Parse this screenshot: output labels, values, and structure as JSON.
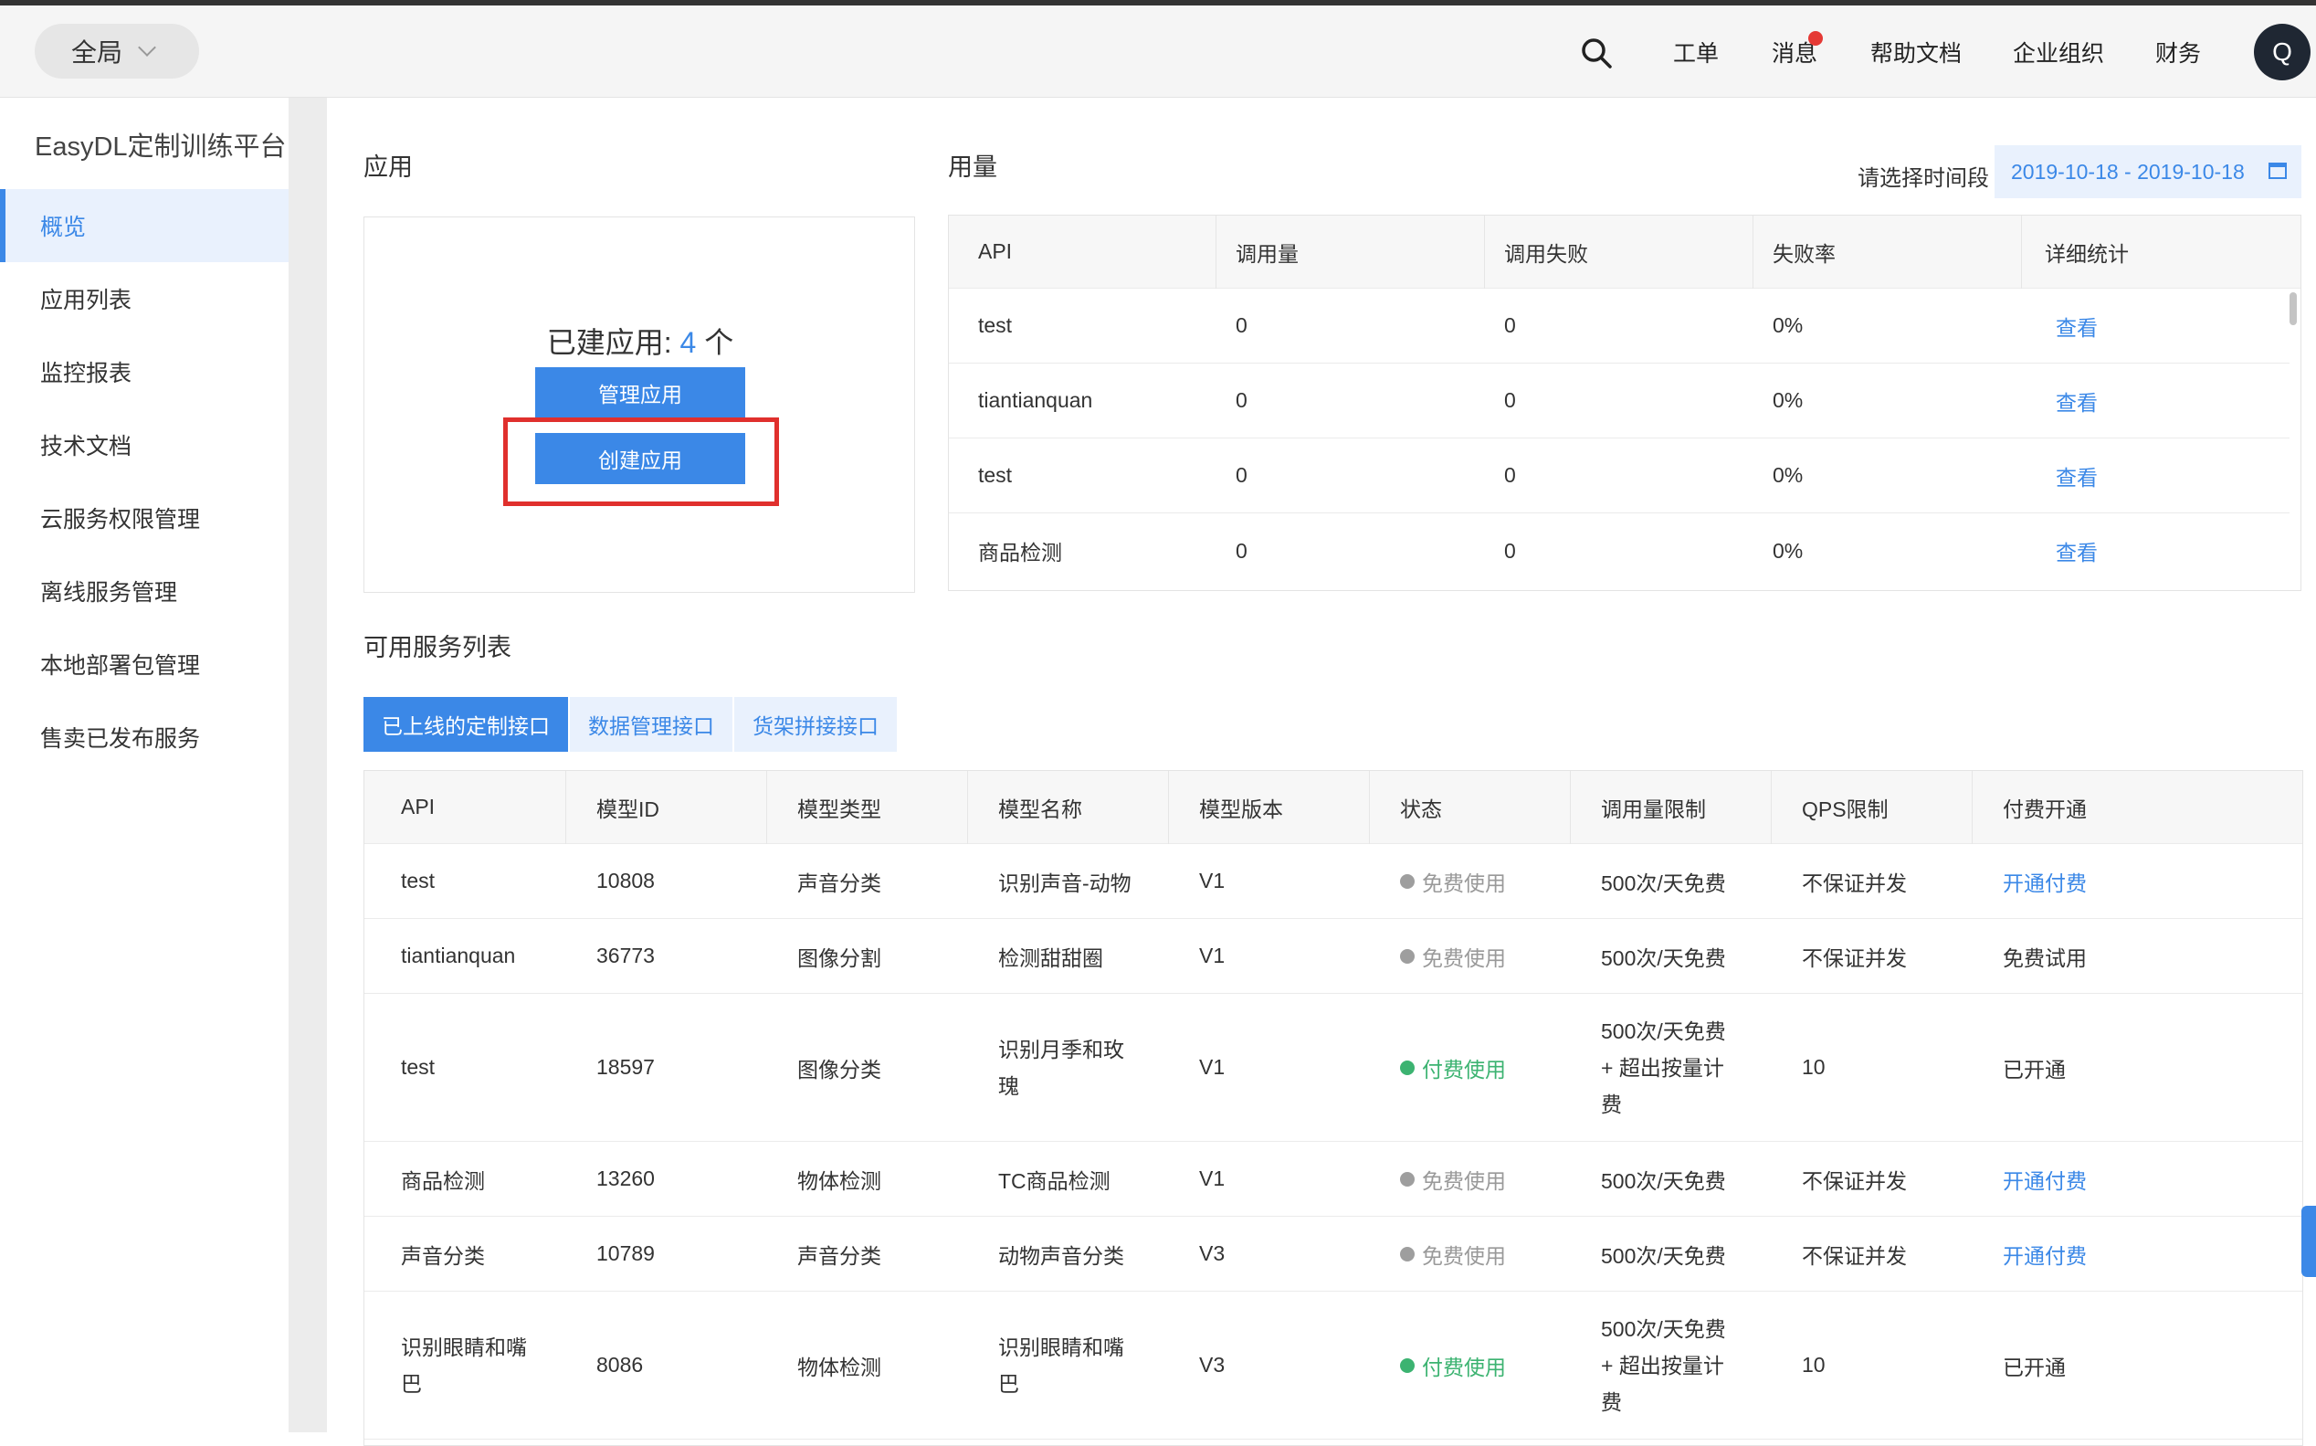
{
  "header": {
    "scope": "全局",
    "nav": [
      {
        "label": "工单"
      },
      {
        "label": "消息"
      },
      {
        "label": "帮助文档"
      },
      {
        "label": "企业组织"
      },
      {
        "label": "财务"
      }
    ],
    "avatar": "Q"
  },
  "sidebar": {
    "title": "EasyDL定制训练平台",
    "items": [
      {
        "label": "概览",
        "active": true
      },
      {
        "label": "应用列表"
      },
      {
        "label": "监控报表"
      },
      {
        "label": "技术文档"
      },
      {
        "label": "云服务权限管理"
      },
      {
        "label": "离线服务管理"
      },
      {
        "label": "本地部署包管理"
      },
      {
        "label": "售卖已发布服务"
      }
    ]
  },
  "app": {
    "title": "应用",
    "count_label": "已建应用: ",
    "count": "4",
    "count_unit": " 个",
    "manage": "管理应用",
    "create": "创建应用"
  },
  "usage": {
    "title": "用量",
    "date_label": "请选择时间段",
    "date_range": "2019-10-18 - 2019-10-18",
    "headers": [
      "API",
      "调用量",
      "调用失败",
      "失败率",
      "详细统计"
    ],
    "rows": [
      {
        "api": "test",
        "calls": "0",
        "fails": "0",
        "rate": "0%",
        "detail": "查看"
      },
      {
        "api": "tiantianquan",
        "calls": "0",
        "fails": "0",
        "rate": "0%",
        "detail": "查看"
      },
      {
        "api": "test",
        "calls": "0",
        "fails": "0",
        "rate": "0%",
        "detail": "查看"
      },
      {
        "api": "商品检测",
        "calls": "0",
        "fails": "0",
        "rate": "0%",
        "detail": "查看"
      }
    ]
  },
  "services": {
    "title": "可用服务列表",
    "tabs": [
      "已上线的定制接口",
      "数据管理接口",
      "货架拼接接口"
    ],
    "headers": [
      "API",
      "模型ID",
      "模型类型",
      "模型名称",
      "模型版本",
      "状态",
      "调用量限制",
      "QPS限制",
      "付费开通"
    ],
    "rows": [
      {
        "api": [
          "test"
        ],
        "id": "10808",
        "type": "声音分类",
        "name": [
          "识别声音-动物"
        ],
        "ver": "V1",
        "status": "免费使用",
        "paid": false,
        "limit": [
          "500次/天免费"
        ],
        "qps": "不保证并发",
        "open": "开通付费",
        "open_link": true
      },
      {
        "api": [
          "tiantianquan"
        ],
        "id": "36773",
        "type": "图像分割",
        "name": [
          "检测甜甜圈"
        ],
        "ver": "V1",
        "status": "免费使用",
        "paid": false,
        "limit": [
          "500次/天免费"
        ],
        "qps": "不保证并发",
        "open": "免费试用",
        "open_link": false
      },
      {
        "api": [
          "test"
        ],
        "id": "18597",
        "type": "图像分类",
        "name": [
          "识别月季和玫",
          "瑰"
        ],
        "ver": "V1",
        "status": "付费使用",
        "paid": true,
        "limit": [
          "500次/天免费",
          "+ 超出按量计",
          "费"
        ],
        "qps": "10",
        "open": "已开通",
        "open_link": false
      },
      {
        "api": [
          "商品检测"
        ],
        "id": "13260",
        "type": "物体检测",
        "name": [
          "TC商品检测"
        ],
        "ver": "V1",
        "status": "免费使用",
        "paid": false,
        "limit": [
          "500次/天免费"
        ],
        "qps": "不保证并发",
        "open": "开通付费",
        "open_link": true
      },
      {
        "api": [
          "声音分类"
        ],
        "id": "10789",
        "type": "声音分类",
        "name": [
          "动物声音分类"
        ],
        "ver": "V3",
        "status": "免费使用",
        "paid": false,
        "limit": [
          "500次/天免费"
        ],
        "qps": "不保证并发",
        "open": "开通付费",
        "open_link": true
      },
      {
        "api": [
          "识别眼睛和嘴",
          "巴"
        ],
        "id": "8086",
        "type": "物体检测",
        "name": [
          "识别眼睛和嘴",
          "巴"
        ],
        "ver": "V3",
        "status": "付费使用",
        "paid": true,
        "limit": [
          "500次/天免费",
          "+ 超出按量计",
          "费"
        ],
        "qps": "10",
        "open": "已开通",
        "open_link": false
      }
    ]
  }
}
